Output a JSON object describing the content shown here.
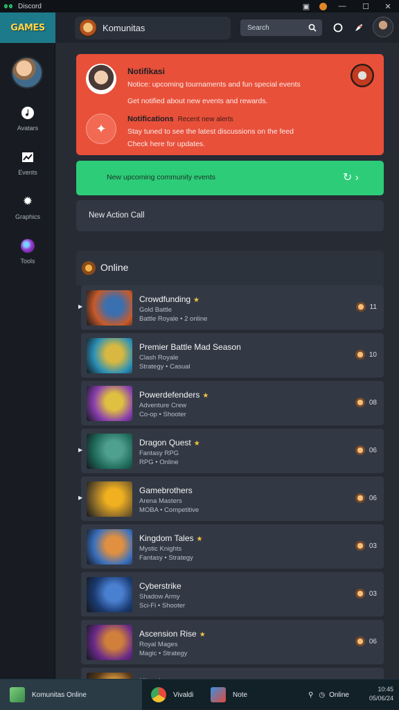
{
  "window": {
    "title": "Discord",
    "minimize": "—",
    "maximize": "☐",
    "close": "✕"
  },
  "brand": {
    "label": "GAMES"
  },
  "sidebar": {
    "items": [
      {
        "label": "Avatars",
        "icon": "music-note-icon"
      },
      {
        "label": "Events",
        "icon": "chart-icon"
      },
      {
        "label": "Graphics",
        "icon": "gear-icon"
      },
      {
        "label": "Tools",
        "icon": "orb-icon"
      }
    ]
  },
  "topbar": {
    "community_label": "Komunitas",
    "search_placeholder": "Search"
  },
  "notification": {
    "title": "Notifikasi",
    "line1": "Notice: upcoming tournaments and fun special events",
    "line2": "Get notified about new events and rewards.",
    "title2": "Notifications",
    "title2_sub": "Recent new alerts",
    "line3": "Stay tuned to see the latest discussions on the feed",
    "line4": "Check here for updates."
  },
  "green_bar": {
    "text": "New upcoming community events",
    "action": "↻ ›"
  },
  "alert_box": {
    "text": "New Action Call"
  },
  "online": {
    "title": "Online",
    "games": [
      {
        "name": "Crowdfunding",
        "sub1": "Gold Battle",
        "sub2": "Battle Royale • 2 online",
        "count": "11",
        "colors": [
          "#c85a2a",
          "#3a6fb0"
        ]
      },
      {
        "name": "Premier Battle Mad Season",
        "sub1": "Clash Royale",
        "sub2": "Strategy • Casual",
        "count": "10",
        "colors": [
          "#2a90b8",
          "#d8b840"
        ]
      },
      {
        "name": "Powerdefenders",
        "sub1": "Adventure Crew",
        "sub2": "Co-op • Shooter",
        "count": "08",
        "colors": [
          "#8a3fb0",
          "#e0c040"
        ]
      },
      {
        "name": "Dragon Quest",
        "sub1": "Fantasy RPG",
        "sub2": "RPG • Online",
        "count": "06",
        "colors": [
          "#1f6a5a",
          "#50a090"
        ]
      },
      {
        "name": "Gamebrothers",
        "sub1": "Arena Masters",
        "sub2": "MOBA • Competitive",
        "count": "06",
        "colors": [
          "#8a6a2a",
          "#f0b020"
        ]
      },
      {
        "name": "Kingdom Tales",
        "sub1": "Mystic Knights",
        "sub2": "Fantasy • Strategy",
        "count": "03",
        "colors": [
          "#3a70c0",
          "#e09040"
        ]
      },
      {
        "name": "Cyberstrike",
        "sub1": "Shadow Army",
        "sub2": "Sci-Fi • Shooter",
        "count": "03",
        "colors": [
          "#1a3a70",
          "#4a80d0"
        ]
      },
      {
        "name": "Ascension Rise",
        "sub1": "Royal Mages",
        "sub2": "Magic • Strategy",
        "count": "06",
        "colors": [
          "#6a2a8a",
          "#d0803a"
        ]
      },
      {
        "name": "Kingdoms",
        "sub1": "",
        "sub2": "",
        "count": "",
        "colors": [
          "#5a3a1a",
          "#e0a040"
        ]
      }
    ]
  },
  "taskbar": {
    "items": [
      {
        "label": "Komunitas Online",
        "icon": "app-icon"
      },
      {
        "label": "Vivaldi",
        "icon": "chrome-icon"
      },
      {
        "label": "Note",
        "icon": "game-icon"
      }
    ],
    "status": "Online",
    "time": "10:45",
    "date": "05/06/24"
  }
}
